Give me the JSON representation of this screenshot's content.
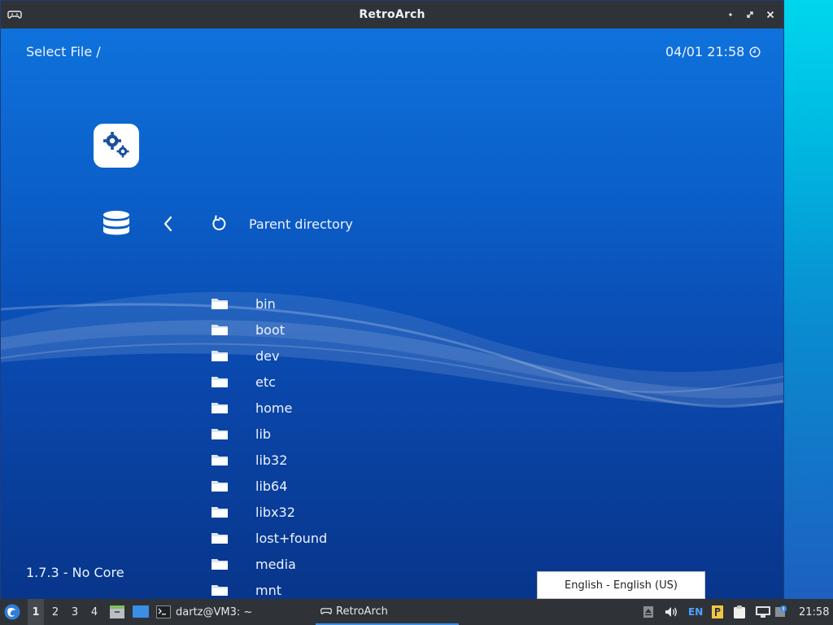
{
  "window": {
    "title": "RetroArch"
  },
  "header": {
    "title": "Select File /",
    "clock": "04/01 21:58"
  },
  "navigation": {
    "parent_label": "Parent directory"
  },
  "files": [
    {
      "name": "bin"
    },
    {
      "name": "boot"
    },
    {
      "name": "dev"
    },
    {
      "name": "etc"
    },
    {
      "name": "home"
    },
    {
      "name": "lib"
    },
    {
      "name": "lib32"
    },
    {
      "name": "lib64"
    },
    {
      "name": "libx32"
    },
    {
      "name": "lost+found"
    },
    {
      "name": "media"
    },
    {
      "name": "mnt"
    }
  ],
  "footer": {
    "version": "1.7.3 - No Core"
  },
  "tooltip": {
    "text": "English - English (US)"
  },
  "taskbar": {
    "workspaces": [
      "1",
      "2",
      "3",
      "4"
    ],
    "terminal_label": "dartz@VM3: ~",
    "retroarch_label": "RetroArch",
    "lang": "EN",
    "clock": "21:58"
  },
  "colors": {
    "accent": "#3a8ee6",
    "panel": "#2f3338",
    "menu_bg": "#0b5ec8"
  },
  "icons": [
    "gamepad-icon",
    "gears-icon",
    "database-icon",
    "chevron-left-icon",
    "refresh-icon",
    "folder-icon",
    "clock-icon"
  ]
}
